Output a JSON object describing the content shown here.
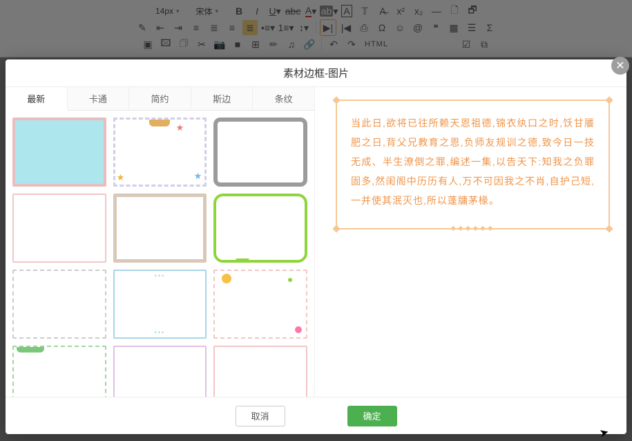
{
  "editor": {
    "font_size": "14px",
    "font_family": "宋体",
    "html_label": "HTML"
  },
  "dialog": {
    "title": "素材边框-图片",
    "tabs": [
      "最新",
      "卡通",
      "简约",
      "斯边",
      "条纹"
    ],
    "active_tab": 0,
    "preview_text": "当此日,欲将已往所赖天恩祖德,锦衣纨口之时,饫甘餍肥之日,背父兄教育之恩,负师友规训之德,致今日一技无成、半生潦倒之罪,编述一集,以告天下:知我之负罪固多,然闺阁中历历有人,万不可因我之不肖,自护己短,一并使其泯灭也,所以蓬牗茅椽。",
    "cancel": "取消",
    "confirm": "确定"
  }
}
